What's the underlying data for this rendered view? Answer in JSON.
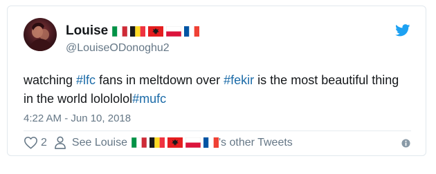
{
  "author": {
    "display_name": "Louise",
    "handle": "@LouiseODonoghu2",
    "flags": [
      "italy-flag",
      "belgium-flag",
      "albania-flag",
      "poland-flag",
      "france-flag"
    ]
  },
  "tweet": {
    "text_parts": [
      {
        "text": "watching ",
        "type": "text"
      },
      {
        "text": "#lfc",
        "type": "hashtag"
      },
      {
        "text": " fans in meltdown over ",
        "type": "text"
      },
      {
        "text": "#fekir",
        "type": "hashtag"
      },
      {
        "text": " is the most beautiful thing in the world lolololol",
        "type": "text"
      },
      {
        "text": "#mufc",
        "type": "hashtag"
      }
    ],
    "timestamp": "4:22 AM - Jun 10, 2018"
  },
  "actions": {
    "like_count": "2",
    "other_prefix": "See Louise",
    "other_suffix": "'s other Tweets"
  },
  "icons": {
    "like": "heart-icon",
    "other_tweets": "person-icon",
    "brand": "twitter-bird-icon",
    "info": "info-icon"
  },
  "colors": {
    "hashtag": "#1b6ba8",
    "secondary_text": "#657786",
    "twitter_blue": "#1da1f2",
    "border": "#e1e8ed"
  }
}
